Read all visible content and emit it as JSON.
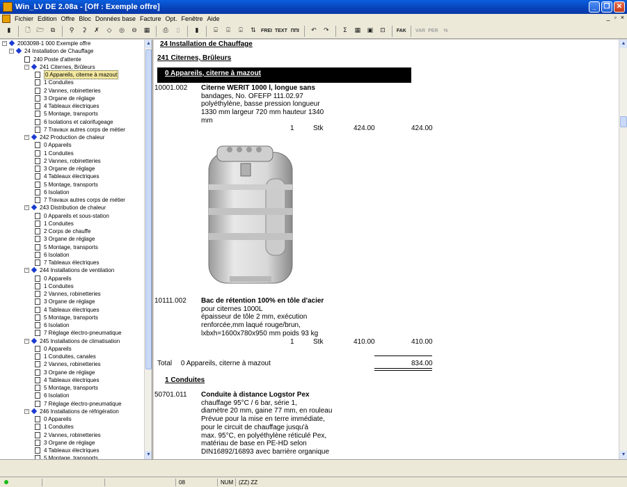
{
  "window": {
    "title": "Win_LV DE 2.08a - [Off   : Exemple offre]"
  },
  "menu": [
    "Fichier",
    "Edition",
    "Offre",
    "Bloc",
    "Données base",
    "Facture",
    "Opt.",
    "Fenêtre",
    "Aide"
  ],
  "mdi_buttons": [
    "_",
    "▫",
    "×"
  ],
  "toolbar": {
    "icons": [
      "exit-icon",
      "new-icon",
      "open-icon",
      "copy-icon",
      "find-icon",
      "find-replace-icon",
      "delete-icon",
      "eraser-icon",
      "ok-icon",
      "calc-icon",
      "form-icon",
      "print-icon",
      "trash-icon",
      "door-icon",
      "properties-icon",
      "tree-icon",
      "cat-icon",
      "sort-icon"
    ],
    "text_buttons": [
      "FREI",
      "TEXT",
      "ΠΠΙ"
    ],
    "more": [
      "↶",
      "↷",
      "Σ",
      "▦",
      "▣",
      "⊡"
    ],
    "fak": "FAK",
    "disabled": [
      "VAR",
      "PER",
      "%"
    ]
  },
  "tree": [
    {
      "level": 0,
      "label": "2003098-1 000 Exemple offre",
      "icon": "diamond",
      "exp": "-"
    },
    {
      "level": 1,
      "label": "24 Installation de Chauffage",
      "icon": "diamond",
      "exp": "-"
    },
    {
      "level": 2,
      "label": "240 Poste d'attente",
      "icon": "doc"
    },
    {
      "level": 2,
      "label": "241 Citernes, Brûleurs",
      "icon": "diamond",
      "exp": "-"
    },
    {
      "level": 3,
      "label": "0 Appareils, citerne à mazout",
      "icon": "doc",
      "selected": true
    },
    {
      "level": 3,
      "label": "1 Conduites",
      "icon": "doc"
    },
    {
      "level": 3,
      "label": "2 Vannes, robinetteries",
      "icon": "doc"
    },
    {
      "level": 3,
      "label": "3 Organe de réglage",
      "icon": "doc"
    },
    {
      "level": 3,
      "label": "4 Tableaux électriques",
      "icon": "doc"
    },
    {
      "level": 3,
      "label": "5 Montage, transports",
      "icon": "doc"
    },
    {
      "level": 3,
      "label": "6 Isolations et calorifugeage",
      "icon": "doc"
    },
    {
      "level": 3,
      "label": "7 Travaux autres corps de métier",
      "icon": "doc"
    },
    {
      "level": 2,
      "label": "242 Production de chaleur",
      "icon": "diamond",
      "exp": "-"
    },
    {
      "level": 3,
      "label": "0 Appareils",
      "icon": "doc"
    },
    {
      "level": 3,
      "label": "1 Conduites",
      "icon": "doc"
    },
    {
      "level": 3,
      "label": "2 Vannes, robinetteries",
      "icon": "doc"
    },
    {
      "level": 3,
      "label": "3 Organe de réglage",
      "icon": "doc"
    },
    {
      "level": 3,
      "label": "4 Tableaux électriques",
      "icon": "doc"
    },
    {
      "level": 3,
      "label": "5 Montage, transports",
      "icon": "doc"
    },
    {
      "level": 3,
      "label": "6 Isolation",
      "icon": "doc"
    },
    {
      "level": 3,
      "label": "7 Travaux autres corps de métier",
      "icon": "doc"
    },
    {
      "level": 2,
      "label": "243 Distribution de chaleur",
      "icon": "diamond",
      "exp": "-"
    },
    {
      "level": 3,
      "label": "0 Appareils et sous-station",
      "icon": "doc"
    },
    {
      "level": 3,
      "label": "1 Conduites",
      "icon": "doc"
    },
    {
      "level": 3,
      "label": "2 Corps de chauffe",
      "icon": "doc"
    },
    {
      "level": 3,
      "label": "3 Organe de réglage",
      "icon": "doc"
    },
    {
      "level": 3,
      "label": "5 Montage, transports",
      "icon": "doc"
    },
    {
      "level": 3,
      "label": "6 Isolation",
      "icon": "doc"
    },
    {
      "level": 3,
      "label": "7 Tableaux électriques",
      "icon": "doc"
    },
    {
      "level": 2,
      "label": "244 Installations de ventilation",
      "icon": "diamond",
      "exp": "-"
    },
    {
      "level": 3,
      "label": "0 Appareils",
      "icon": "doc"
    },
    {
      "level": 3,
      "label": "1 Conduites",
      "icon": "doc"
    },
    {
      "level": 3,
      "label": "2 Vannes, robinetteries",
      "icon": "doc"
    },
    {
      "level": 3,
      "label": "3 Organe de réglage",
      "icon": "doc"
    },
    {
      "level": 3,
      "label": "4 Tableaux électriques",
      "icon": "doc"
    },
    {
      "level": 3,
      "label": "5 Montage, transports",
      "icon": "doc"
    },
    {
      "level": 3,
      "label": "6 Isolation",
      "icon": "doc"
    },
    {
      "level": 3,
      "label": "7 Réglage électro-pneumatique",
      "icon": "doc"
    },
    {
      "level": 2,
      "label": "245 Installations de climatisation",
      "icon": "diamond",
      "exp": "-"
    },
    {
      "level": 3,
      "label": "0 Appareils",
      "icon": "doc"
    },
    {
      "level": 3,
      "label": "1 Conduites, canales",
      "icon": "doc"
    },
    {
      "level": 3,
      "label": "2 Vannes, robinetteries",
      "icon": "doc"
    },
    {
      "level": 3,
      "label": "3 Organe de réglage",
      "icon": "doc"
    },
    {
      "level": 3,
      "label": "4 Tableaux électriques",
      "icon": "doc"
    },
    {
      "level": 3,
      "label": "5 Montage, transports",
      "icon": "doc"
    },
    {
      "level": 3,
      "label": "6 Isolation",
      "icon": "doc"
    },
    {
      "level": 3,
      "label": "7 Réglage électro-pneumatique",
      "icon": "doc"
    },
    {
      "level": 2,
      "label": "246 Installations de réfrigération",
      "icon": "diamond",
      "exp": "-"
    },
    {
      "level": 3,
      "label": "0 Appareils",
      "icon": "doc"
    },
    {
      "level": 3,
      "label": "1 Conduites",
      "icon": "doc"
    },
    {
      "level": 3,
      "label": "2 Vannes, robinetteries",
      "icon": "doc"
    },
    {
      "level": 3,
      "label": "3 Organe de réglage",
      "icon": "doc"
    },
    {
      "level": 3,
      "label": "4 Tableaux électriques",
      "icon": "doc"
    },
    {
      "level": 3,
      "label": "5 Montage, transports",
      "icon": "doc"
    }
  ],
  "document": {
    "h1": "24 Installation de Chauffage",
    "h2": "241 Citernes, Brûleurs",
    "h3": "0 Appareils, citerne à mazout",
    "pos1": {
      "num": "10001.002",
      "title": "Citerne WERIT 1000 l, longue sans",
      "lines": [
        "bandages, No. OFEFP 111.02.97",
        "polyéthylène, basse pression longueur",
        "1330 mm largeur    720 mm hauteur   1340",
        "mm"
      ],
      "qty": "1",
      "unit": "Stk",
      "price": "424.00",
      "total": "424.00"
    },
    "pos2": {
      "num": "10111.002",
      "title": "Bac de rétention 100% en tôle d'acier",
      "lines": [
        "pour citernes 1000L",
        "épaisseur de tôle 2 mm, exécution",
        "renforcée,mm laqué rouge/brun,",
        "lxbxh=1600x780x950 mm poids 93 kg"
      ],
      "qty": "1",
      "unit": "Stk",
      "price": "410.00",
      "total": "410.00"
    },
    "total_label": "Total",
    "total_group": "0 Appareils, citerne à mazout",
    "total_value": "834.00",
    "h3b": "1 Conduites",
    "pos3": {
      "num": "50701.011",
      "title": "Conduite à distance Logstor Pex",
      "lines": [
        "chauffage 95°C / 6 bar, série 1,",
        "diamètre 20 mm, gaine 77 mm, en rouleau",
        "Prévue pour la mise en terre immédiate,",
        "pour le circuit de chauffage jusqu'à",
        "max. 95°C, en polyéthylène réticulé Pex,",
        "matériau de base en PE-HD selon",
        "DIN16892/16893 avec barrière organique"
      ]
    }
  },
  "status": {
    "page": "08",
    "num": "NUM",
    "zz": "(ZZ) ZZ"
  }
}
